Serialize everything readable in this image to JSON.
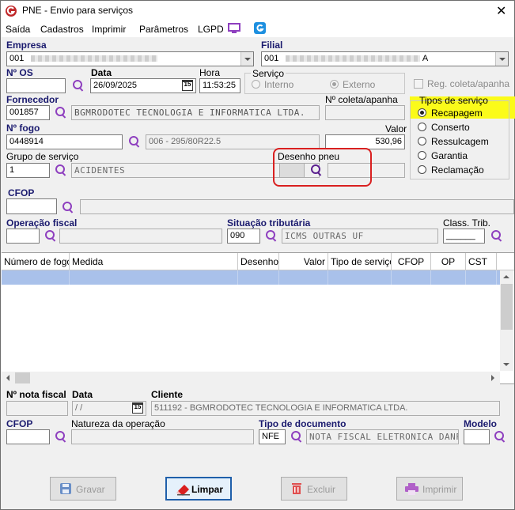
{
  "window": {
    "title": "PNE - Envio para serviços",
    "close": "✕"
  },
  "menu": {
    "items": [
      "Saída",
      "Cadastros",
      "Imprimir",
      "Parâmetros",
      "LGPD"
    ]
  },
  "empresa": {
    "label": "Empresa",
    "value": "001"
  },
  "filial": {
    "label": "Filial",
    "value": "001",
    "suffix": "A"
  },
  "os": {
    "label": "Nº  OS",
    "value": ""
  },
  "data": {
    "label": "Data",
    "value": "26/09/2025"
  },
  "hora": {
    "label": "Hora",
    "value": "11:53:25"
  },
  "servico": {
    "label": "Serviço",
    "options": [
      "Interno",
      "Externo"
    ]
  },
  "reg_coleta": {
    "label": "Reg. coleta/apanha"
  },
  "fornecedor": {
    "label": "Fornecedor",
    "code": "001857",
    "name": "BGMRODOTEC TECNOLOGIA E INFORMATICA LTDA."
  },
  "n_coleta": {
    "label": "Nº coleta/apanha",
    "value": ""
  },
  "tipos_servico": {
    "label": "Tipos de serviço",
    "options": [
      "Recapagem",
      "Conserto",
      "Ressulcagem",
      "Garantia",
      "Reclamação"
    ],
    "selected": "Recapagem"
  },
  "fogo": {
    "label": "Nº  fogo",
    "value": "0448914",
    "desc": "006 - 295/80R22.5"
  },
  "valor": {
    "label": "Valor",
    "value": "530,96"
  },
  "grupo_servico": {
    "label": "Grupo de serviço",
    "code": "1",
    "name": "ACIDENTES"
  },
  "desenho_pneu": {
    "label": "Desenho pneu",
    "value": ""
  },
  "cfop": {
    "label": "CFOP",
    "value": ""
  },
  "operacao_fiscal": {
    "label": "Operação fiscal",
    "value": ""
  },
  "situacao_tributaria": {
    "label": "Situação tributária",
    "code": "090",
    "name": "ICMS OUTRAS UF"
  },
  "class_trib": {
    "label": "Class. Trib.",
    "value": "______"
  },
  "grid": {
    "columns": [
      "Número de fogo",
      "Medida",
      "Desenho",
      "Valor",
      "Tipo de serviço",
      "CFOP",
      "OP",
      "CST"
    ]
  },
  "nota_fiscal": {
    "label": "Nº nota fiscal",
    "value": ""
  },
  "data_nf": {
    "label": "Data",
    "value": " /  /"
  },
  "cliente": {
    "label": "Cliente",
    "value": "511192 - BGMRODOTEC TECNOLOGIA E INFORMATICA LTDA."
  },
  "cfop2": {
    "label": "CFOP",
    "value": ""
  },
  "natureza": {
    "label": "Natureza da operação",
    "value": ""
  },
  "tipo_documento": {
    "label": "Tipo de documento",
    "code": "NFE",
    "name": "NOTA FISCAL ELETRONICA DANFE"
  },
  "modelo": {
    "label": "Modelo",
    "value": ""
  },
  "buttons": {
    "gravar": "Gravar",
    "limpar": "Limpar",
    "excluir": "Excluir",
    "imprimir": "Imprimir"
  },
  "colors": {
    "highlight": "#fbfb1a",
    "annotation": "#d92020",
    "accent": "#8e3fbf",
    "grid_selection": "#a9c1ea"
  }
}
